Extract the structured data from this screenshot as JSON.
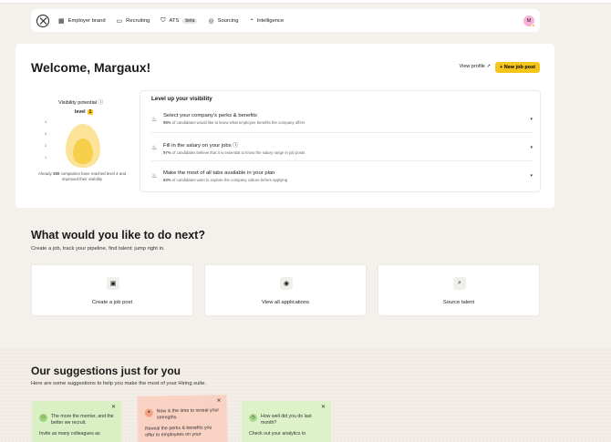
{
  "nav": {
    "items": [
      {
        "icon": "building-icon",
        "glyph": "▦",
        "label": "Employer brand"
      },
      {
        "icon": "folder-icon",
        "glyph": "▭",
        "label": "Recruiting"
      },
      {
        "icon": "ats-icon",
        "glyph": "⛉",
        "label": "ATS"
      },
      {
        "icon": "user-circle-icon",
        "glyph": "◎",
        "label": "Sourcing"
      },
      {
        "icon": "chart-icon",
        "glyph": "◔",
        "label": "Intelligence"
      }
    ],
    "beta": "beta",
    "avatar": "M"
  },
  "welcome": {
    "title": "Welcome, Margaux!",
    "view_profile": "View profile ↗",
    "new_job": "+ New job post"
  },
  "visibility": {
    "title": "Visibility potential ⓘ",
    "level_label": "level",
    "level_value": "1",
    "ticks": [
      "4",
      "3",
      "2",
      "1"
    ],
    "note_prefix": "Already ",
    "note_count": "350",
    "note_suffix": " companies have reached level 4 and improved their visibility"
  },
  "levelup": {
    "title": "Level up your visibility",
    "rows": [
      {
        "title": "Select your company's perks & benefits",
        "pct": "98%",
        "desc": " of candidates would like to know what employee benefits the company offers"
      },
      {
        "title": "Fill in the salary on your jobs ⓘ",
        "pct": "97%",
        "desc": " of candidates believe that it is essential to know the salary range in job posts"
      },
      {
        "title": "Make the most of all tabs available in your plan",
        "pct": "83%",
        "desc": " of candidates want to explore the company culture before applying"
      }
    ]
  },
  "next": {
    "title": "What would you like to do next?",
    "subtitle": "Create a job, track your pipeline, find talent: jump right in.",
    "cards": [
      {
        "icon": "briefcase-icon",
        "glyph": "▣",
        "label": "Create a job post"
      },
      {
        "icon": "eye-icon",
        "glyph": "◉",
        "label": "View all applications"
      },
      {
        "icon": "search-icon",
        "glyph": "⌕",
        "label": "Source talent"
      }
    ]
  },
  "suggestions": {
    "title": "Our suggestions just for you",
    "subtitle": "Here are some suggestions to help you make the most of your Hiring suite.",
    "notes": [
      {
        "color": "#d8f0c4",
        "icon_color": "#9fd57a",
        "title": "The more the merrier, and the better we recruit.",
        "body": "Invite as many colleagues as"
      },
      {
        "color": "#fad2c4",
        "icon_color": "#f2a07e",
        "title": "Now is the time to reveal your strengths.",
        "body": "Reveal the perks & benefits you offer to employees on your"
      },
      {
        "color": "#ddf2c8",
        "icon_color": "#a9d98a",
        "title": "How well did you do last month?",
        "body": "Check out your analytics to"
      }
    ]
  }
}
